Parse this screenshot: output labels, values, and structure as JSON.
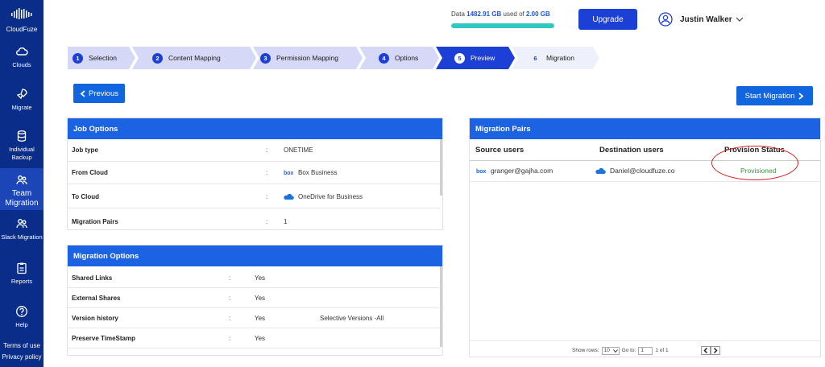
{
  "brand": {
    "name": "CloudFuze"
  },
  "sidebar": {
    "items": [
      {
        "label": "Clouds"
      },
      {
        "label": "Migrate"
      },
      {
        "label": "Individual Backup"
      },
      {
        "label": "Team Migration"
      },
      {
        "label": "Slack Migration"
      },
      {
        "label": "Reports"
      },
      {
        "label": "Help"
      }
    ],
    "footer": {
      "terms": "Terms of use",
      "privacy": "Privacy policy"
    }
  },
  "header": {
    "usage_prefix": "Data",
    "usage_used": "1482.91 GB",
    "usage_mid": "used of",
    "usage_total": "2.00 GB",
    "usage_fraction": 1.0,
    "upgrade_label": "Upgrade",
    "user_name": "Justin Walker"
  },
  "stepper": {
    "steps": [
      {
        "num": "1",
        "label": "Selection"
      },
      {
        "num": "2",
        "label": "Content Mapping"
      },
      {
        "num": "3",
        "label": "Permission Mapping"
      },
      {
        "num": "4",
        "label": "Options"
      },
      {
        "num": "5",
        "label": "Preview"
      },
      {
        "num": "6",
        "label": "Migration"
      }
    ],
    "active_index": 4
  },
  "buttons": {
    "previous": "Previous",
    "start_migration": "Start Migration"
  },
  "job_options": {
    "title": "Job Options",
    "sep": ":",
    "rows": [
      {
        "key": "Job type",
        "value": "ONETIME"
      },
      {
        "key": "From Cloud",
        "value": "Box Business"
      },
      {
        "key": "To Cloud",
        "value": "OneDrive for Business"
      },
      {
        "key": "Migration Pairs",
        "value": "1"
      }
    ]
  },
  "migration_options": {
    "title": "Migration Options",
    "sep": ":",
    "rows": [
      {
        "key": "Shared Links",
        "value": "Yes",
        "extra": ""
      },
      {
        "key": "External Shares",
        "value": "Yes",
        "extra": ""
      },
      {
        "key": "Version history",
        "value": "Yes",
        "extra": "Selective Versions -All"
      },
      {
        "key": "Preserve TimeStamp",
        "value": "Yes",
        "extra": ""
      }
    ]
  },
  "migration_pairs": {
    "title": "Migration Pairs",
    "headers": {
      "source": "Source users",
      "destination": "Destination users",
      "status": "Provision Status"
    },
    "rows": [
      {
        "source": "granger@gajha.com",
        "destination": "Daniel@cloudfuze.co",
        "status": "Provisioned"
      }
    ],
    "pager": {
      "show_rows": "Show rows:",
      "rows_value": "10",
      "goto": "Go to:",
      "goto_value": "1",
      "of": "1 of 1"
    }
  },
  "colors": {
    "sidebar": "#0a2d8a",
    "accent": "#1c63e4",
    "status_ok": "#2e9b3a",
    "highlight": "#d32020"
  },
  "icons": {
    "box": "box-logo-icon",
    "onedrive": "onedrive-cloud-icon"
  }
}
